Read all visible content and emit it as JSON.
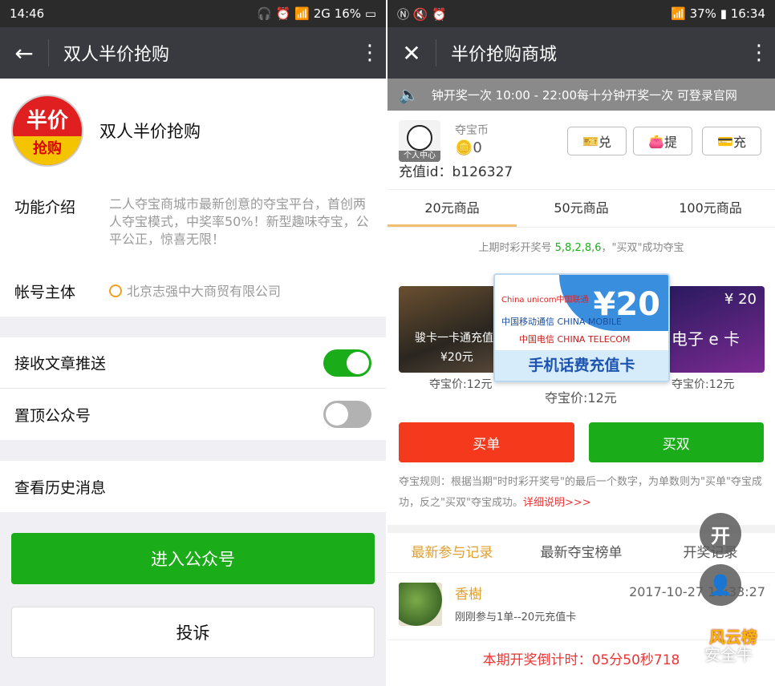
{
  "left": {
    "status": {
      "time": "14:46",
      "network": "2G",
      "battery": "16%"
    },
    "appbar": {
      "title": "双人半价抢购"
    },
    "profile": {
      "logo_top": "半价",
      "logo_bottom": "抢购",
      "name": "双人半价抢购"
    },
    "info": {
      "intro_label": "功能介绍",
      "intro_value": "二人夺宝商城市最新创意的夺宝平台，首创两人夺宝模式，中奖率50%！新型趣味夺宝，公平公正，惊喜无限！",
      "owner_label": "帐号主体",
      "owner_value": "北京志强中大商贸有限公司"
    },
    "settings": {
      "push_label": "接收文章推送",
      "push_on": true,
      "pin_label": "置顶公众号",
      "pin_on": false
    },
    "history_label": "查看历史消息",
    "enter_label": "进入公众号",
    "complain_label": "投诉"
  },
  "right": {
    "status": {
      "battery": "37%",
      "time": "16:34"
    },
    "appbar": {
      "title": "半价抢购商城"
    },
    "marquee": "钟开奖一次  10:00 - 22:00每十分钟开奖一次    可登录官网",
    "account": {
      "avatar_caption": "个人中心",
      "coin_label": "夺宝币",
      "coins": "0",
      "recharge_id": "充值id：b126327",
      "btn_exchange": "兑",
      "btn_withdraw": "提",
      "btn_charge": "充"
    },
    "tabs": [
      "20元商品",
      "50元商品",
      "100元商品"
    ],
    "last_draw": {
      "prefix": "上期时彩开奖号",
      "numbers": "5,8,2,8,6",
      "suffix": "，\"买双\"成功夺宝"
    },
    "cards": {
      "left_title": "骏卡一卡通充值",
      "left_price_tag": "¥20元",
      "left_price": "夺宝价:12元",
      "center_amount": "¥20",
      "center_brand1": "China unicom中国联通",
      "center_brand2": "中国移动通信 CHINA MOBILE",
      "center_brand3": "中国电信 CHINA TELECOM",
      "center_title": "手机话费充值卡",
      "center_price": "夺宝价:12元",
      "right_amount": "¥ 20",
      "right_title": "电子 e 卡",
      "right_price": "夺宝价:12元"
    },
    "actions": {
      "buy_odd": "买单",
      "buy_even": "买双"
    },
    "rules": {
      "text": "夺宝规则：根据当期\"时时彩开奖号\"的最后一个数字，为单数则为\"买单\"夺宝成功，反之\"买双\"夺宝成功。",
      "link": "详细说明>>>"
    },
    "record_tabs": [
      "最新参与记录",
      "最新夺宝榜单",
      "开奖记录"
    ],
    "record": {
      "name": "香樹",
      "time": "2017-10-27 16:33:27",
      "detail": "刚刚参与1单--20元充值卡"
    },
    "countdown": "本期开奖倒计时：05分50秒718",
    "float_open": "开",
    "watermark": "安全牛",
    "watermark2": "风云榜"
  }
}
